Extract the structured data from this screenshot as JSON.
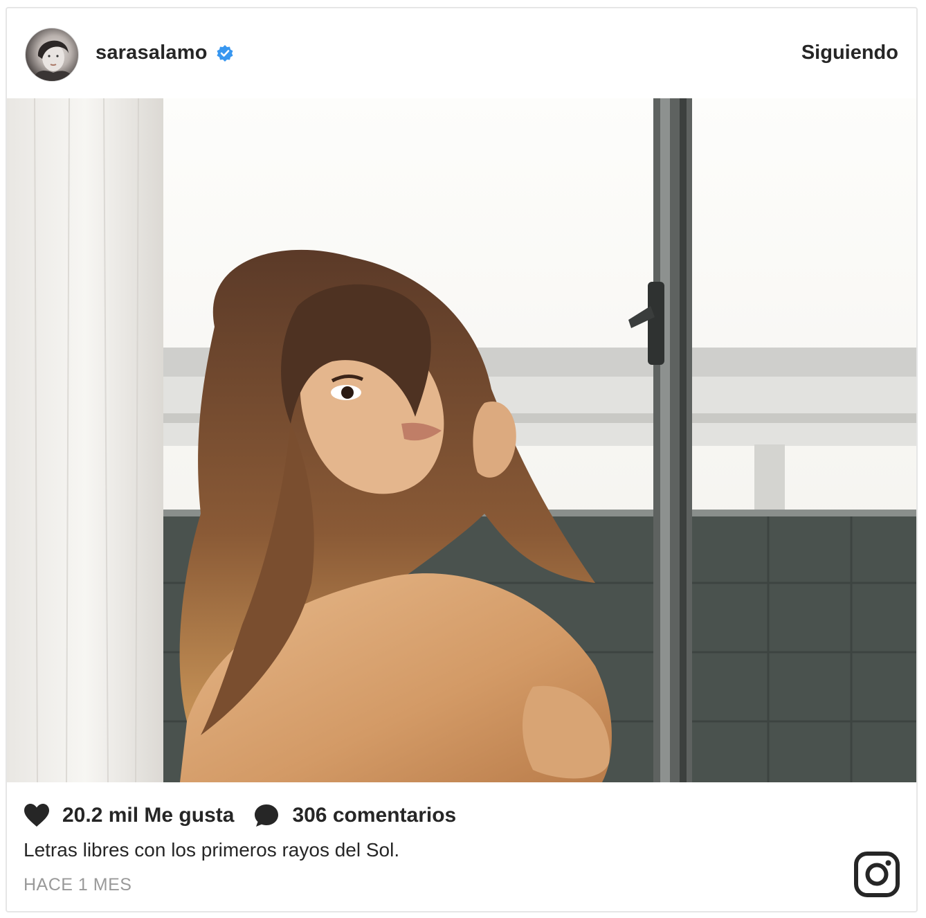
{
  "post": {
    "username": "sarasalamo",
    "follow_label": "Siguiendo",
    "likes_label": "20.2 mil Me gusta",
    "comments_label": "306 comentarios",
    "caption": "Letras libres con los primeros rayos del Sol.",
    "timestamp": "HACE 1 MES"
  },
  "icons": {
    "verified": "verified-badge-icon",
    "like": "heart-icon",
    "comment": "speech-bubble-icon",
    "brand": "instagram-logo-icon"
  },
  "colors": {
    "verified_blue": "#3897f0",
    "text": "#262626",
    "muted": "#999999",
    "border": "#e6e6e6"
  }
}
